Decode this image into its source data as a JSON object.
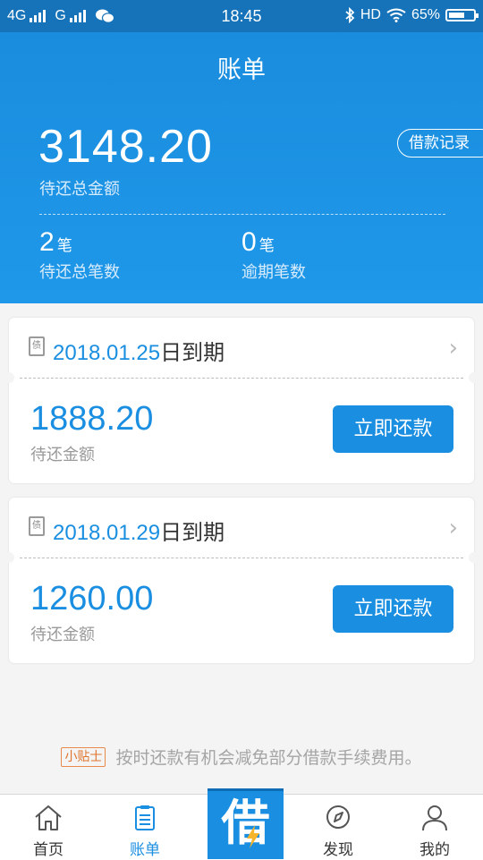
{
  "status_bar": {
    "net1": "4G",
    "net2": "G",
    "time": "18:45",
    "hd": "HD",
    "battery": "65%"
  },
  "header": {
    "title": "账单",
    "total_amount": "3148.20",
    "total_label": "待还总金额",
    "records_button": "借款记录",
    "pending_count": "2",
    "pending_unit": "笔",
    "pending_label": "待还总笔数",
    "overdue_count": "0",
    "overdue_unit": "笔",
    "overdue_label": "逾期笔数"
  },
  "bills": [
    {
      "date": "2018.01.25",
      "suffix": "日到期",
      "amount": "1888.20",
      "amount_label": "待还金额",
      "pay_label": "立即还款"
    },
    {
      "date": "2018.01.29",
      "suffix": "日到期",
      "amount": "1260.00",
      "amount_label": "待还金额",
      "pay_label": "立即还款"
    }
  ],
  "tip": {
    "tag": "小贴士",
    "text": "按时还款有机会减免部分借款手续费用。"
  },
  "tabbar": {
    "home": "首页",
    "bills": "账单",
    "center": "借",
    "discover": "发现",
    "mine": "我的"
  },
  "colors": {
    "accent": "#1a8ee0",
    "status_bar": "#1673b9",
    "tip_tag": "#e0742d"
  },
  "icons": [
    "wifi-icon",
    "bluetooth-icon",
    "wechat-icon",
    "bill-icon",
    "chevron-right-icon",
    "home-icon",
    "bill-list-icon",
    "compass-icon",
    "user-icon",
    "bolt-icon"
  ]
}
